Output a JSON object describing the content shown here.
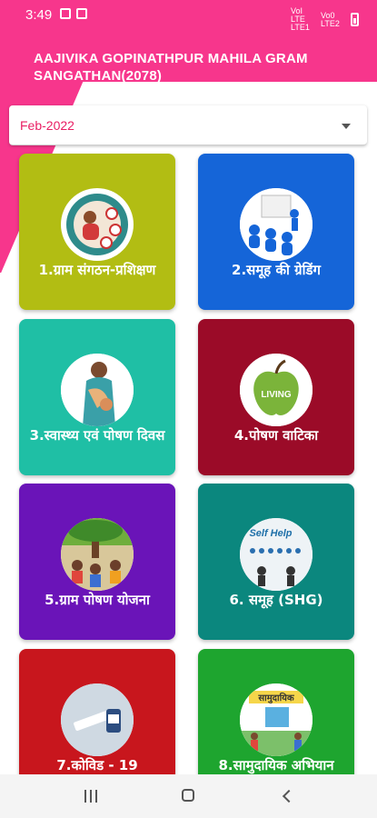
{
  "status_bar": {
    "time": "3:49",
    "net1": "VoI LTE LTE1",
    "net2": "Vo0 LTE2"
  },
  "header": {
    "title": "AAJIVIKA GOPINATHPUR MAHILA GRAM SANGATHAN(2078)"
  },
  "month_selector": {
    "selected": "Feb-2022"
  },
  "colors": {
    "header_pink": "#f7368c",
    "tile_1": "#b2bd13",
    "tile_2": "#1565d8",
    "tile_3": "#1fbfa5",
    "tile_4": "#9b0b28",
    "tile_5": "#6a14b8",
    "tile_6": "#0b877e",
    "tile_7": "#c8161d",
    "tile_8": "#1ea52f"
  },
  "tiles": [
    {
      "label": "1.ग्राम संगठन-प्रशिक्षण",
      "icon": "training-icon"
    },
    {
      "label": "2.समूह की ग्रेडिंग",
      "icon": "presentation-icon"
    },
    {
      "label": "3.स्वास्थ्य एवं पोषण दिवस",
      "icon": "mother-child-icon"
    },
    {
      "label": "4.पोषण वाटिका",
      "icon": "apple-icon"
    },
    {
      "label": "5.ग्राम पोषण योजना",
      "icon": "village-meeting-icon"
    },
    {
      "label": "6. समूह (SHG)",
      "icon": "self-help-icon"
    },
    {
      "label": "7.कोविड - 19",
      "icon": "vaccine-icon"
    },
    {
      "label": "8.सामुदायिक अभियान",
      "icon": "community-icon"
    }
  ],
  "tile_images": {
    "self_help_text": "Self Help",
    "living_text": "LIVING",
    "community_text": "सामुदायिक"
  }
}
